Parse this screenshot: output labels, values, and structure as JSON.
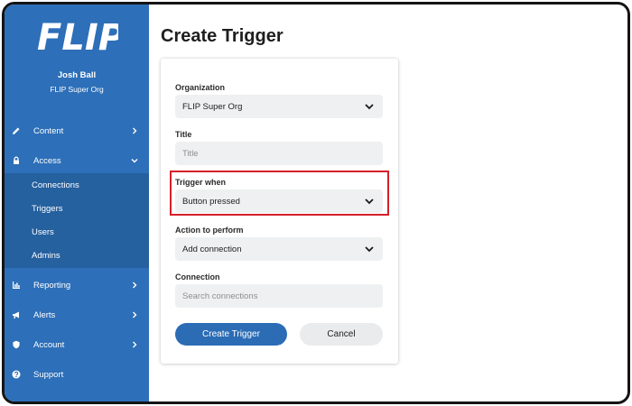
{
  "brand": {
    "logo_text": "FLIP",
    "sidebar_color": "#2d6fb8",
    "submenu_color": "#25609f"
  },
  "user": {
    "name": "Josh Ball",
    "org": "FLIP Super Org"
  },
  "nav": {
    "content": {
      "label": "Content",
      "icon": "pencil-icon"
    },
    "access": {
      "label": "Access",
      "icon": "lock-icon",
      "expanded": true
    },
    "access_items": [
      "Connections",
      "Triggers",
      "Users",
      "Admins"
    ],
    "reporting": {
      "label": "Reporting",
      "icon": "bar-chart-icon"
    },
    "alerts": {
      "label": "Alerts",
      "icon": "megaphone-icon"
    },
    "account": {
      "label": "Account",
      "icon": "shield-icon"
    },
    "support": {
      "label": "Support",
      "icon": "question-icon"
    }
  },
  "page": {
    "title": "Create Trigger"
  },
  "form": {
    "organization": {
      "label": "Organization",
      "value": "FLIP Super Org"
    },
    "title": {
      "label": "Title",
      "placeholder": "Title"
    },
    "trigger_when": {
      "label": "Trigger when",
      "value": "Button pressed",
      "highlighted": true
    },
    "action": {
      "label": "Action to perform",
      "value": "Add connection"
    },
    "connection": {
      "label": "Connection",
      "placeholder": "Search connections"
    },
    "create_button": "Create Trigger",
    "cancel_button": "Cancel"
  },
  "colors": {
    "primary": "#2b6cb5",
    "highlight_border": "#d62029"
  }
}
